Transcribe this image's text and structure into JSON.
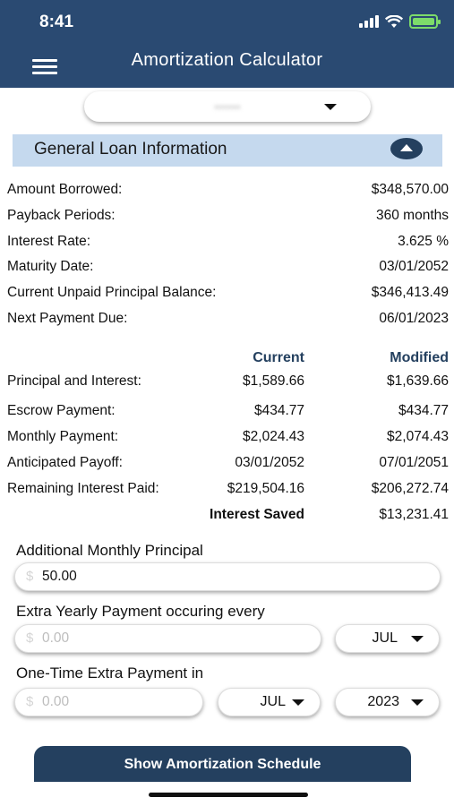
{
  "status": {
    "time": "8:41",
    "battery_color": "#7ddc6a"
  },
  "header": {
    "title": "Amortization Calculator",
    "bg": "#2a4a72"
  },
  "loan_selector": {
    "value": "••••••"
  },
  "section": {
    "title": "General Loan Information"
  },
  "loan_info": [
    {
      "label": "Amount Borrowed:",
      "value": "$348,570.00"
    },
    {
      "label": "Payback Periods:",
      "value": "360 months"
    },
    {
      "label": "Interest Rate:",
      "value": "3.625 %"
    },
    {
      "label": "Maturity Date:",
      "value": "03/01/2052"
    },
    {
      "label": "Current Unpaid Principal Balance:",
      "value": "$346,413.49"
    },
    {
      "label": "Next Payment Due:",
      "value": "06/01/2023"
    }
  ],
  "compare": {
    "current_header": "Current",
    "modified_header": "Modified",
    "rows": [
      {
        "label": "Principal and Interest:",
        "current": "$1,589.66",
        "modified": "$1,639.66"
      },
      {
        "label": "Escrow Payment:",
        "current": "$434.77",
        "modified": "$434.77"
      },
      {
        "label": "Monthly Payment:",
        "current": "$2,024.43",
        "modified": "$2,074.43"
      },
      {
        "label": "Anticipated Payoff:",
        "current": "03/01/2052",
        "modified": "07/01/2051"
      },
      {
        "label": "Remaining Interest Paid:",
        "current": "$219,504.16",
        "modified": "$206,272.74"
      }
    ],
    "saved_label": "Interest Saved",
    "saved_value": "$13,231.41"
  },
  "form": {
    "dollar_sign": "$",
    "additional_label": "Additional Monthly Principal",
    "additional_value": "50.00",
    "yearly_label": "Extra Yearly Payment occuring every",
    "yearly_placeholder": "0.00",
    "yearly_month": "JUL",
    "onetime_label": "One-Time Extra Payment in",
    "onetime_placeholder": "0.00",
    "onetime_month": "JUL",
    "onetime_year": "2023"
  },
  "schedule_button": {
    "label": "Show Amortization Schedule"
  }
}
